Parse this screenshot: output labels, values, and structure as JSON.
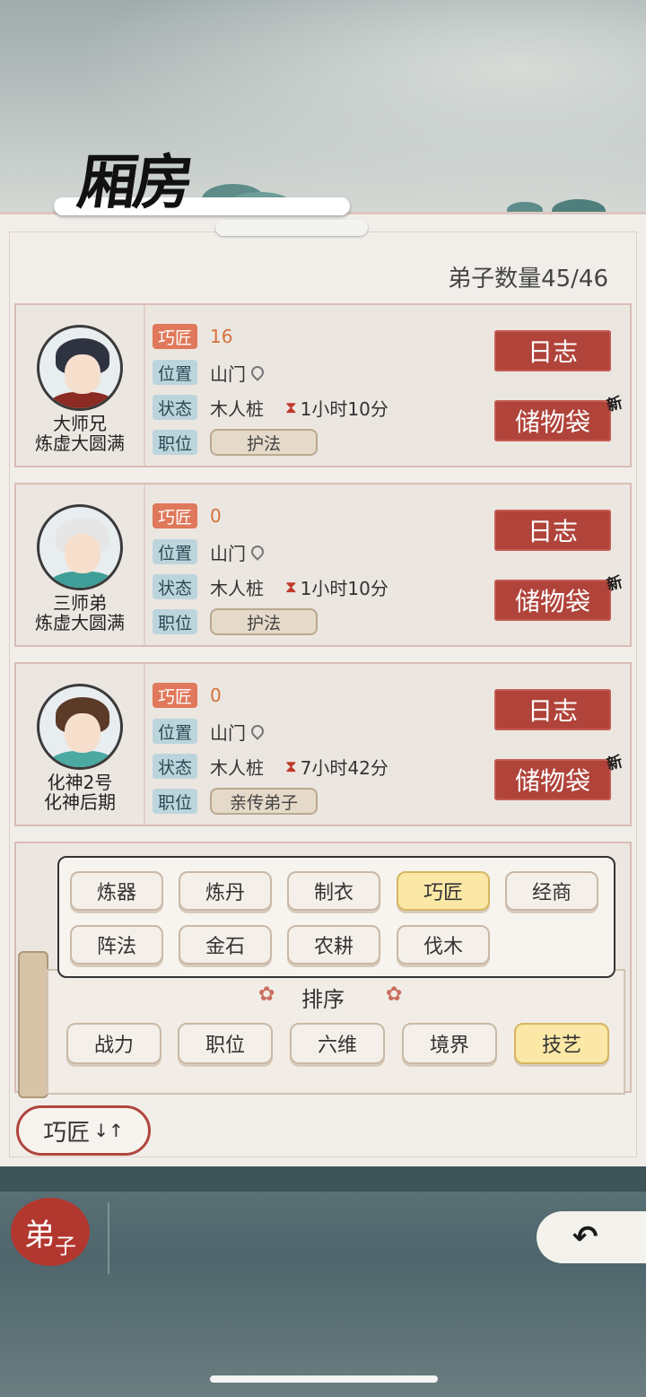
{
  "header": {
    "title": "厢房"
  },
  "disciple_count": "弟子数量45/46",
  "labels": {
    "skill": "巧匠",
    "location": "位置",
    "status": "状态",
    "post": "职位"
  },
  "cards": [
    {
      "name": "大师兄",
      "realm": "炼虚大圆满",
      "skill_value": "16",
      "location": "山门",
      "status": "木人桩",
      "timer": "1小时10分",
      "post": "护法",
      "log_label": "日志",
      "bag_label": "储物袋",
      "new_badge": "新"
    },
    {
      "name": "三师弟",
      "realm": "炼虚大圆满",
      "skill_value": "0",
      "location": "山门",
      "status": "木人桩",
      "timer": "1小时10分",
      "post": "护法",
      "log_label": "日志",
      "bag_label": "储物袋",
      "new_badge": "新"
    },
    {
      "name": "化神2号",
      "realm": "化神后期",
      "skill_value": "0",
      "location": "山门",
      "status": "木人桩",
      "timer": "7小时42分",
      "post": "亲传弟子",
      "log_label": "日志",
      "bag_label": "储物袋",
      "new_badge": "新"
    }
  ],
  "filter": {
    "options": [
      "炼器",
      "炼丹",
      "制衣",
      "巧匠",
      "经商",
      "阵法",
      "金石",
      "农耕",
      "伐木"
    ],
    "selected": "巧匠"
  },
  "sort": {
    "title": "排序",
    "options": [
      "战力",
      "职位",
      "六维",
      "境界",
      "技艺"
    ],
    "selected": "技艺",
    "toggle_label": "巧匠",
    "toggle_icon": "↓↑"
  },
  "bottom_nav": {
    "tab_main": "弟",
    "tab_sub": "子",
    "back_icon": "↶"
  },
  "colors": {
    "accent_red": "#b0433a",
    "selected_yellow": "#fbe8a6",
    "tag_blue": "#bcd5dd"
  }
}
